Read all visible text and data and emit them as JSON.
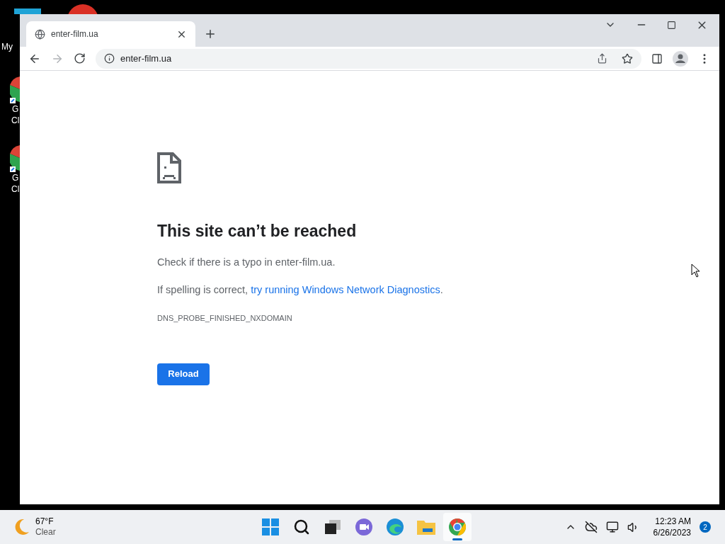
{
  "desktop": {
    "icons": [
      {
        "kind": "computer",
        "lines": [
          "My"
        ]
      },
      {
        "kind": "shortcut",
        "lines": [
          "G",
          "Cl"
        ]
      },
      {
        "kind": "shortcut",
        "lines": [
          "G",
          "Cl"
        ]
      }
    ]
  },
  "window": {
    "tabs": [
      {
        "title": "enter-film.ua",
        "selected": true
      }
    ],
    "address": "enter-film.ua",
    "forward_disabled": true
  },
  "error_page": {
    "heading": "This site can’t be reached",
    "hint": "Check if there is a typo in enter-film.ua.",
    "suggestion_prefix": "If spelling is correct, ",
    "suggestion_link": "try running Windows Network Diagnostics",
    "suggestion_suffix": ".",
    "code": "DNS_PROBE_FINISHED_NXDOMAIN",
    "button": "Reload"
  },
  "taskbar": {
    "weather": {
      "temperature": "67°F",
      "condition": "Clear"
    },
    "apps": [
      {
        "kind": "start",
        "selected": false
      },
      {
        "kind": "search",
        "selected": false
      },
      {
        "kind": "taskview",
        "selected": false
      },
      {
        "kind": "chat",
        "selected": false
      },
      {
        "kind": "edge",
        "selected": false
      },
      {
        "kind": "explorer",
        "selected": false
      },
      {
        "kind": "chrome",
        "selected": true
      }
    ],
    "time": "12:23 AM",
    "date": "6/26/2023",
    "notifications": "2"
  }
}
